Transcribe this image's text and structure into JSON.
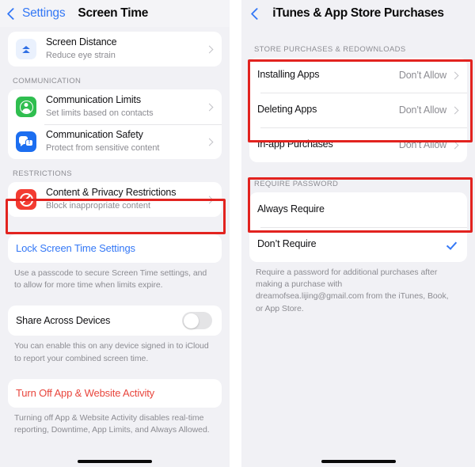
{
  "left": {
    "nav": {
      "back_label": "Settings",
      "title": "Screen Time"
    },
    "rows_top": [
      {
        "title": "Screen Distance",
        "subtitle": "Reduce eye strain",
        "icon": "screen-distance-icon",
        "icon_color": "#eaf1fd",
        "accessory": "chevron-right-icon"
      }
    ],
    "communication": {
      "header": "COMMUNICATION",
      "rows": [
        {
          "title": "Communication Limits",
          "subtitle": "Set limits based on contacts",
          "icon": "person-circle-icon",
          "icon_color": "#2fbe4f",
          "accessory": "chevron-right-icon"
        },
        {
          "title": "Communication Safety",
          "subtitle": "Protect from sensitive content",
          "icon": "message-alert-icon",
          "icon_color": "#1c6ef0",
          "accessory": "chevron-right-icon"
        }
      ]
    },
    "restrictions": {
      "header": "RESTRICTIONS",
      "rows": [
        {
          "title": "Content & Privacy Restrictions",
          "subtitle": "Block inappropriate content",
          "icon": "no-entry-icon",
          "icon_color": "#f33c32",
          "accessory": "chevron-right-icon"
        }
      ]
    },
    "lock": {
      "title": "Lock Screen Time Settings",
      "footnote": "Use a passcode to secure Screen Time settings, and to allow for more time when limits expire."
    },
    "share": {
      "title": "Share Across Devices",
      "toggle_on": false,
      "footnote": "You can enable this on any device signed in to iCloud to report your combined screen time."
    },
    "turn_off": {
      "title": "Turn Off App & Website Activity",
      "footnote": "Turning off App & Website Activity disables real-time reporting, Downtime, App Limits, and Always Allowed."
    }
  },
  "right": {
    "nav": {
      "back_label": "",
      "title": "iTunes & App Store Purchases"
    },
    "store": {
      "header": "STORE PURCHASES & REDOWNLOADS",
      "rows": [
        {
          "title": "Installing Apps",
          "value": "Don’t Allow",
          "accessory": "chevron-right-icon"
        },
        {
          "title": "Deleting Apps",
          "value": "Don’t Allow",
          "accessory": "chevron-right-icon"
        },
        {
          "title": "In-app Purchases",
          "value": "Don’t Allow",
          "accessory": "chevron-right-icon"
        }
      ]
    },
    "password": {
      "header": "REQUIRE PASSWORD",
      "rows": [
        {
          "title": "Always Require",
          "selected": false
        },
        {
          "title": "Don’t Require",
          "selected": true
        }
      ],
      "footnote": "Require a password for additional purchases after making a purchase with dreamofsea.lijing@gmail.com from the iTunes, Book, or App Store."
    }
  },
  "colors": {
    "highlight": "#e2231f",
    "accent_blue": "#3478f6",
    "danger_red": "#e8453c",
    "panel_bg": "#f1f1f5",
    "card_bg": "#ffffff"
  }
}
